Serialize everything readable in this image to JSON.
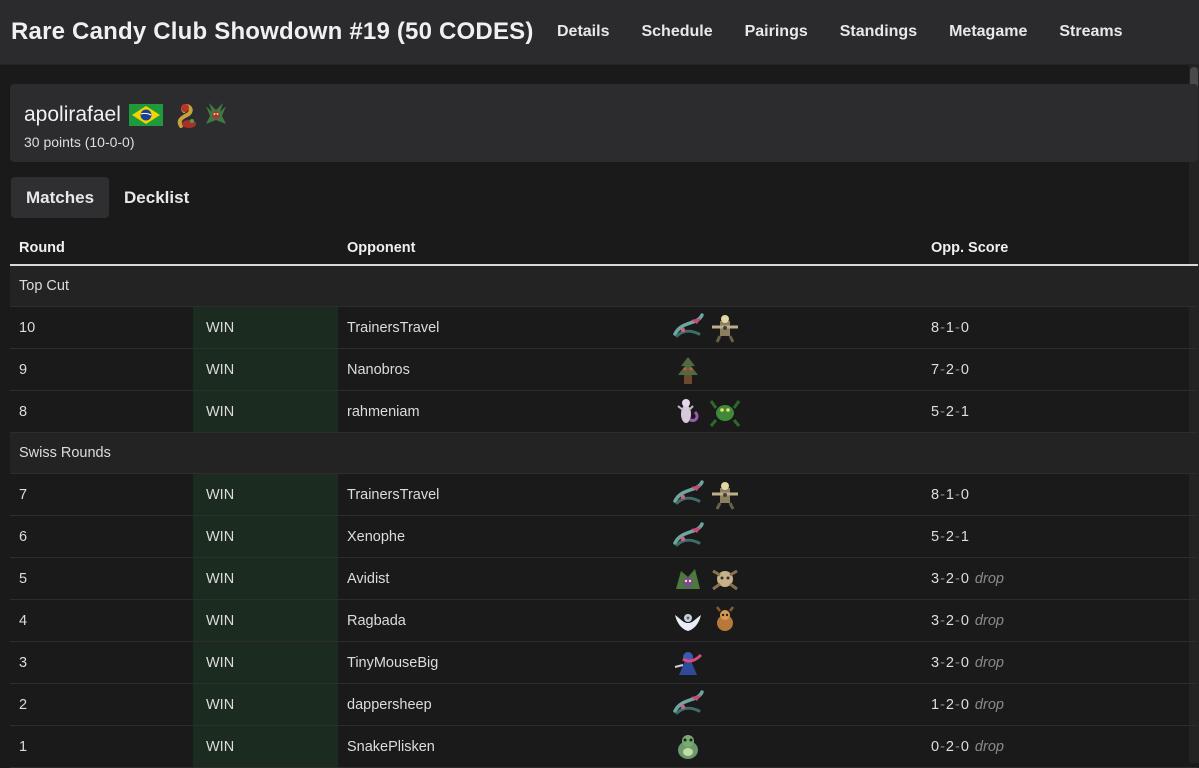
{
  "header": {
    "title": "Rare Candy Club Showdown #19 (50 CODES)",
    "nav": [
      "Details",
      "Schedule",
      "Pairings",
      "Standings",
      "Metagame",
      "Streams"
    ]
  },
  "player": {
    "name": "apolirafael",
    "flag": "brazil-flag-icon",
    "deck_icons": [
      "pokemon-sprite-red-serpent",
      "pokemon-sprite-green-dragon"
    ],
    "record": "30 points (10-0-0)"
  },
  "tabs": [
    "Matches",
    "Decklist"
  ],
  "table": {
    "headers": {
      "round": "Round",
      "opponent": "Opponent",
      "score": "Opp. Score"
    },
    "sections": [
      {
        "label": "Top Cut",
        "rows": [
          {
            "round": "10",
            "result": "WIN",
            "opponent": "TrainersTravel",
            "sprites": [
              "dragapult-icon",
              "trainer-icon"
            ],
            "score": [
              "8",
              "1",
              "0"
            ],
            "drop": ""
          },
          {
            "round": "9",
            "result": "WIN",
            "opponent": "Nanobros",
            "sprites": [
              "forest-pokemon-icon"
            ],
            "score": [
              "7",
              "2",
              "0"
            ],
            "drop": ""
          },
          {
            "round": "8",
            "result": "WIN",
            "opponent": "rahmeniam",
            "sprites": [
              "mewtwo-icon",
              "green-bug-icon"
            ],
            "score": [
              "5",
              "2",
              "1"
            ],
            "drop": ""
          }
        ]
      },
      {
        "label": "Swiss Rounds",
        "rows": [
          {
            "round": "7",
            "result": "WIN",
            "opponent": "TrainersTravel",
            "sprites": [
              "dragapult-icon",
              "trainer-icon"
            ],
            "score": [
              "8",
              "1",
              "0"
            ],
            "drop": ""
          },
          {
            "round": "6",
            "result": "WIN",
            "opponent": "Xenophe",
            "sprites": [
              "dragapult-icon"
            ],
            "score": [
              "5",
              "2",
              "1"
            ],
            "drop": ""
          },
          {
            "round": "5",
            "result": "WIN",
            "opponent": "Avidist",
            "sprites": [
              "purple-green-pokemon-icon",
              "tan-pokemon-icon"
            ],
            "score": [
              "3",
              "2",
              "0"
            ],
            "drop": "drop"
          },
          {
            "round": "4",
            "result": "WIN",
            "opponent": "Ragbada",
            "sprites": [
              "white-winged-pokemon-icon",
              "orange-pokemon-icon"
            ],
            "score": [
              "3",
              "2",
              "0"
            ],
            "drop": "drop"
          },
          {
            "round": "3",
            "result": "WIN",
            "opponent": "TinyMouseBig",
            "sprites": [
              "greninja-icon"
            ],
            "score": [
              "3",
              "2",
              "0"
            ],
            "drop": "drop"
          },
          {
            "round": "2",
            "result": "WIN",
            "opponent": "dappersheep",
            "sprites": [
              "dragapult-icon"
            ],
            "score": [
              "1",
              "2",
              "0"
            ],
            "drop": "drop"
          },
          {
            "round": "1",
            "result": "WIN",
            "opponent": "SnakePlisken",
            "sprites": [
              "green-round-pokemon-icon"
            ],
            "score": [
              "0",
              "2",
              "0"
            ],
            "drop": "drop"
          }
        ]
      }
    ]
  }
}
